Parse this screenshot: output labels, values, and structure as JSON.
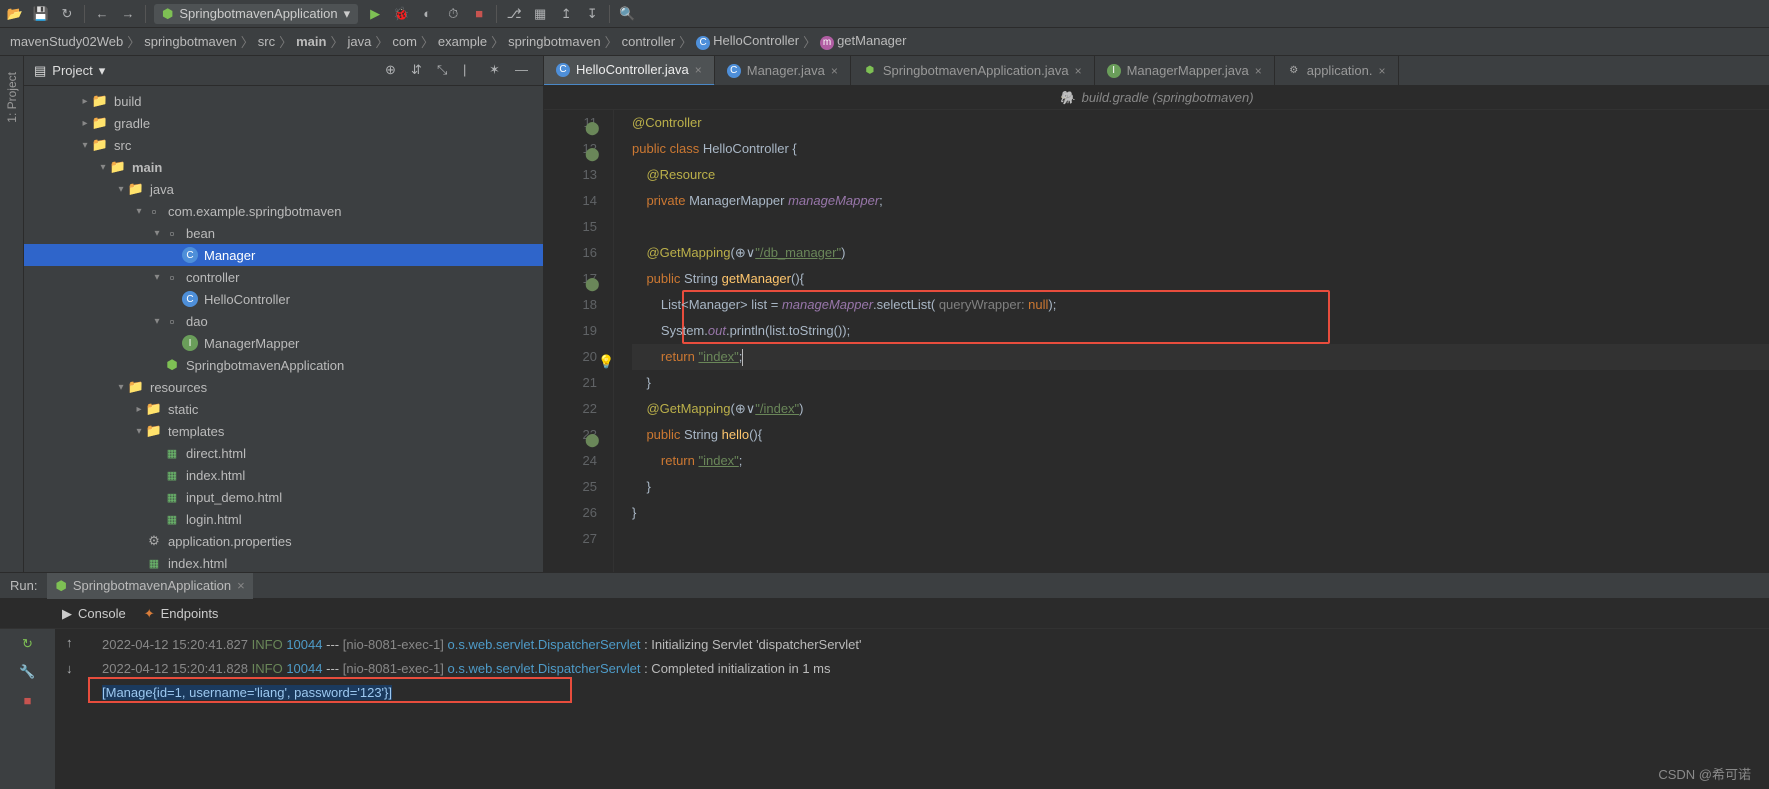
{
  "toolbar": {
    "runConfig": "SpringbotmavenApplication"
  },
  "breadcrumb": [
    "mavenStudy02Web",
    "springbotmaven",
    "src",
    "main",
    "java",
    "com",
    "example",
    "springbotmaven",
    "controller",
    "HelloController",
    "getManager"
  ],
  "projectPanel": {
    "title": "Project"
  },
  "tree": [
    {
      "indent": 3,
      "arrow": ">",
      "icon": "fold",
      "label": "build"
    },
    {
      "indent": 3,
      "arrow": ">",
      "icon": "fold-g",
      "label": "gradle"
    },
    {
      "indent": 3,
      "arrow": "v",
      "icon": "fold-b",
      "label": "src"
    },
    {
      "indent": 4,
      "arrow": "v",
      "icon": "fold-b",
      "label": "main",
      "bold": true
    },
    {
      "indent": 5,
      "arrow": "v",
      "icon": "fold-b",
      "label": "java"
    },
    {
      "indent": 6,
      "arrow": "v",
      "icon": "pkg",
      "label": "com.example.springbotmaven"
    },
    {
      "indent": 7,
      "arrow": "v",
      "icon": "pkg",
      "label": "bean"
    },
    {
      "indent": 8,
      "arrow": "",
      "icon": "cls",
      "label": "Manager",
      "sel": true
    },
    {
      "indent": 7,
      "arrow": "v",
      "icon": "pkg",
      "label": "controller"
    },
    {
      "indent": 8,
      "arrow": "",
      "icon": "cls",
      "label": "HelloController"
    },
    {
      "indent": 7,
      "arrow": "v",
      "icon": "pkg",
      "label": "dao"
    },
    {
      "indent": 8,
      "arrow": "",
      "icon": "int",
      "label": "ManagerMapper"
    },
    {
      "indent": 7,
      "arrow": "",
      "icon": "spring",
      "label": "SpringbotmavenApplication"
    },
    {
      "indent": 5,
      "arrow": "v",
      "icon": "fold-g",
      "label": "resources"
    },
    {
      "indent": 6,
      "arrow": ">",
      "icon": "fold-g",
      "label": "static"
    },
    {
      "indent": 6,
      "arrow": "v",
      "icon": "fold-g",
      "label": "templates"
    },
    {
      "indent": 7,
      "arrow": "",
      "icon": "html",
      "label": "direct.html"
    },
    {
      "indent": 7,
      "arrow": "",
      "icon": "html",
      "label": "index.html"
    },
    {
      "indent": 7,
      "arrow": "",
      "icon": "html",
      "label": "input_demo.html"
    },
    {
      "indent": 7,
      "arrow": "",
      "icon": "html",
      "label": "login.html"
    },
    {
      "indent": 6,
      "arrow": "",
      "icon": "prop",
      "label": "application.properties"
    },
    {
      "indent": 6,
      "arrow": "",
      "icon": "html",
      "label": "index.html"
    }
  ],
  "tabs": [
    {
      "icon": "cls",
      "label": "HelloController.java",
      "active": true
    },
    {
      "icon": "cls",
      "label": "Manager.java"
    },
    {
      "icon": "spring",
      "label": "SpringbotmavenApplication.java"
    },
    {
      "icon": "int",
      "label": "ManagerMapper.java"
    },
    {
      "icon": "prop",
      "label": "application."
    }
  ],
  "subtab": "build.gradle (springbotmaven)",
  "code": {
    "startLine": 11,
    "lines": [
      {
        "n": 11,
        "gi": "impl",
        "html": "<span class='ann'>@Controller</span>"
      },
      {
        "n": 12,
        "gi": "impl",
        "html": "<span class='kw'>public class </span><span class='type'>HelloController </span>{"
      },
      {
        "n": 13,
        "html": "<span class='guide'>····</span><span class='ann'>@Resource</span>"
      },
      {
        "n": 14,
        "html": "<span class='guide'>····</span><span class='kw'>private </span><span class='type'>ManagerMapper </span><span class='field'>manageMapper</span>;"
      },
      {
        "n": 15,
        "html": ""
      },
      {
        "n": 16,
        "html": "<span class='guide'>····</span><span class='ann'>@GetMapping</span>(<span class='type'>⊕∨</span><span class='str-u'>\"/db_manager\"</span>)"
      },
      {
        "n": 17,
        "gi": "impl",
        "html": "<span class='guide'>····</span><span class='kw'>public </span><span class='type'>String </span><span class='method'>getManager</span>(){"
      },
      {
        "n": 18,
        "html": "<span class='guide'>········</span><span class='type'>List&lt;Manager&gt; </span><span>list = </span><span class='field'>manageMapper</span>.<span>selectList</span>(<span class='param'> queryWrapper: </span><span class='kw'>null</span>);"
      },
      {
        "n": 19,
        "html": "<span class='guide'>········</span><span class='type'>System</span>.<span class='purple ital'>out</span>.<span>println</span>(list.toString());"
      },
      {
        "n": 20,
        "cursor": true,
        "bulb": true,
        "html": "<span class='guide'>········</span><span class='kw'>return </span><span class='str-u'>\"index\"</span>;<span class='caret'></span>"
      },
      {
        "n": 21,
        "html": "<span class='guide'>····</span>}"
      },
      {
        "n": 22,
        "html": "<span class='guide'>····</span><span class='ann'>@GetMapping</span>(<span class='type'>⊕∨</span><span class='str-u'>\"/index\"</span>)"
      },
      {
        "n": 23,
        "gi": "impl",
        "html": "<span class='guide'>····</span><span class='kw'>public </span><span class='type'>String </span><span class='method'>hello</span>(){"
      },
      {
        "n": 24,
        "html": "<span class='guide'>········</span><span class='kw'>return </span><span class='str-u'>\"index\"</span>;"
      },
      {
        "n": 25,
        "html": "<span class='guide'>····</span>}"
      },
      {
        "n": 26,
        "html": "}"
      },
      {
        "n": 27,
        "html": ""
      }
    ]
  },
  "run": {
    "label": "Run:",
    "tab": "SpringbotmavenApplication",
    "subtabs": [
      "Console",
      "Endpoints"
    ],
    "lines": [
      {
        "ts": "2022-04-12 15:20:41.827",
        "lvl": "INFO",
        "pid": "10044",
        "thr": "[nio-8081-exec-1]",
        "log": "o.s.web.servlet.DispatcherServlet",
        "msg": ": Initializing Servlet 'dispatcherServlet'"
      },
      {
        "ts": "2022-04-12 15:20:41.828",
        "lvl": "INFO",
        "pid": "10044",
        "thr": "[nio-8081-exec-1]",
        "log": "o.s.web.servlet.DispatcherServlet",
        "msg": ": Completed initialization in 1 ms"
      }
    ],
    "output": "[Manage{id=1, username='liang', password='123'}]"
  },
  "watermark": "CSDN @希可诺"
}
